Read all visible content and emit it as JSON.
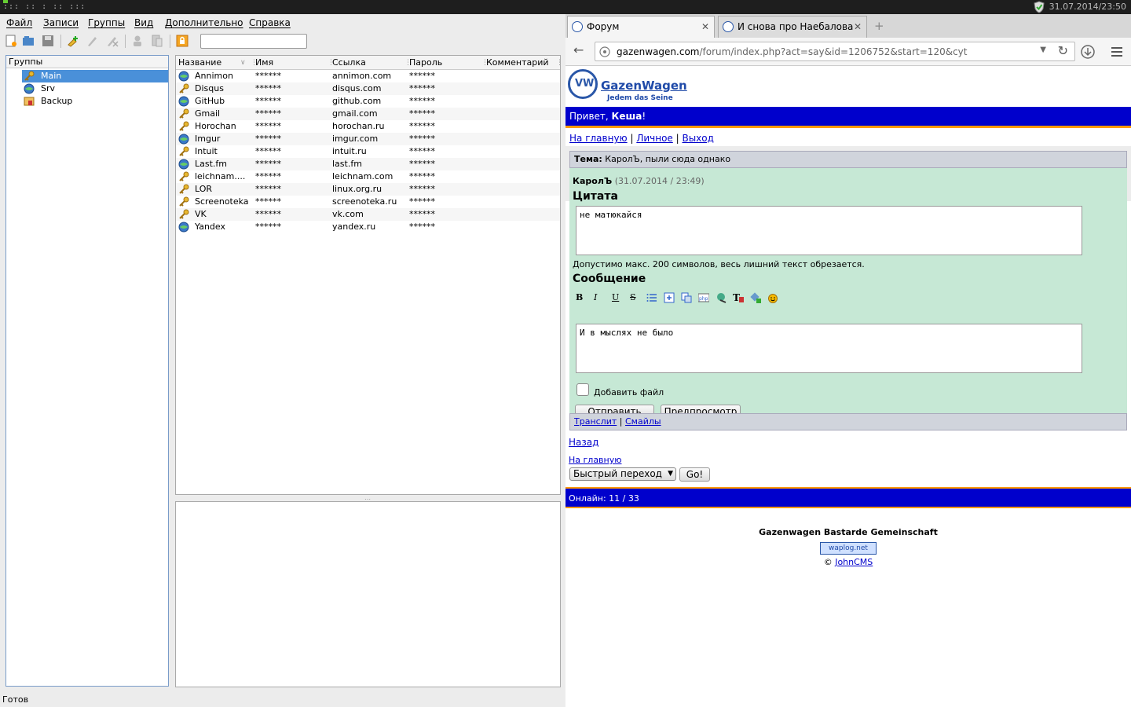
{
  "system": {
    "workspaces": "::: :: : :: :::",
    "clock": "31.07.2014/23:50"
  },
  "app": {
    "menu": [
      "Файл",
      "Записи",
      "Группы",
      "Вид",
      "Дополнительно",
      "Справка"
    ],
    "groups_header": "Группы",
    "groups": [
      "Main",
      "Srv",
      "Backup"
    ],
    "columns": [
      "Название",
      "Имя",
      "Ссылка",
      "Пароль",
      "Комментарий"
    ],
    "entries": [
      {
        "title": "Annimon",
        "user": "******",
        "url": "annimon.com",
        "pass": "******",
        "icon": "globe-icon"
      },
      {
        "title": "Disqus",
        "user": "******",
        "url": "disqus.com",
        "pass": "******",
        "icon": "key-icon"
      },
      {
        "title": "GitHub",
        "user": "******",
        "url": "github.com",
        "pass": "******",
        "icon": "globe-icon"
      },
      {
        "title": "Gmail",
        "user": "******",
        "url": "gmail.com",
        "pass": "******",
        "icon": "key-icon"
      },
      {
        "title": "Horochan",
        "user": "******",
        "url": "horochan.ru",
        "pass": "******",
        "icon": "key-icon"
      },
      {
        "title": "Imgur",
        "user": "******",
        "url": "imgur.com",
        "pass": "******",
        "icon": "globe-icon"
      },
      {
        "title": "Intuit",
        "user": "******",
        "url": "intuit.ru",
        "pass": "******",
        "icon": "key-icon"
      },
      {
        "title": "Last.fm",
        "user": "******",
        "url": "last.fm",
        "pass": "******",
        "icon": "globe-icon"
      },
      {
        "title": "leichnam....",
        "user": "******",
        "url": "leichnam.com",
        "pass": "******",
        "icon": "key-icon"
      },
      {
        "title": "LOR",
        "user": "******",
        "url": "linux.org.ru",
        "pass": "******",
        "icon": "key-icon"
      },
      {
        "title": "Screenoteka",
        "user": "******",
        "url": "screenoteka.ru",
        "pass": "******",
        "icon": "key-icon"
      },
      {
        "title": "VK",
        "user": "******",
        "url": "vk.com",
        "pass": "******",
        "icon": "key-icon"
      },
      {
        "title": "Yandex",
        "user": "******",
        "url": "yandex.ru",
        "pass": "******",
        "icon": "globe-icon"
      }
    ],
    "status": "Готов"
  },
  "browser": {
    "tabs": [
      "Форум",
      "И снова про Наебалова"
    ],
    "url_host": "gazenwagen.com",
    "url_path": "/forum/index.php?act=say&id=1206752&start=120&cyt",
    "site": {
      "brand": "GazenWagen",
      "tagline": "Jedem das Seine",
      "greeting_prefix": "Привет, ",
      "greeting_user": "Кеша",
      "greeting_suffix": "!",
      "nav": [
        "На главную",
        "Личное",
        "Выход"
      ],
      "topic_label": "Тема:",
      "topic_title": "КаролЪ, пыли сюда однако",
      "author": "КаролЪ",
      "post_date": "(31.07.2014 / 23:49)",
      "quote_heading": "Цитата",
      "quote_text": "не матюкайся",
      "limit_note": "Допустимо макс. 200 символов, весь лишний текст обрезается.",
      "message_heading": "Сообщение",
      "message_text": "И в мыслях не было",
      "attach_label": "Добавить файл",
      "send_button": "Отправить",
      "preview_button": "Предпросмотр",
      "translit_link": "Транслит",
      "smiles_link": "Смайлы",
      "back_link": "Назад",
      "home_link": "На главную",
      "quick_jump": "Быстрый переход",
      "go_button": "Go!",
      "online": "Онлайн: 11 / 33",
      "community": "Gazenwagen Bastarde Gemeinschaft",
      "counter_badge": "waplog.net",
      "copyright_prefix": "© ",
      "copyright_link": "JohnCMS"
    }
  }
}
